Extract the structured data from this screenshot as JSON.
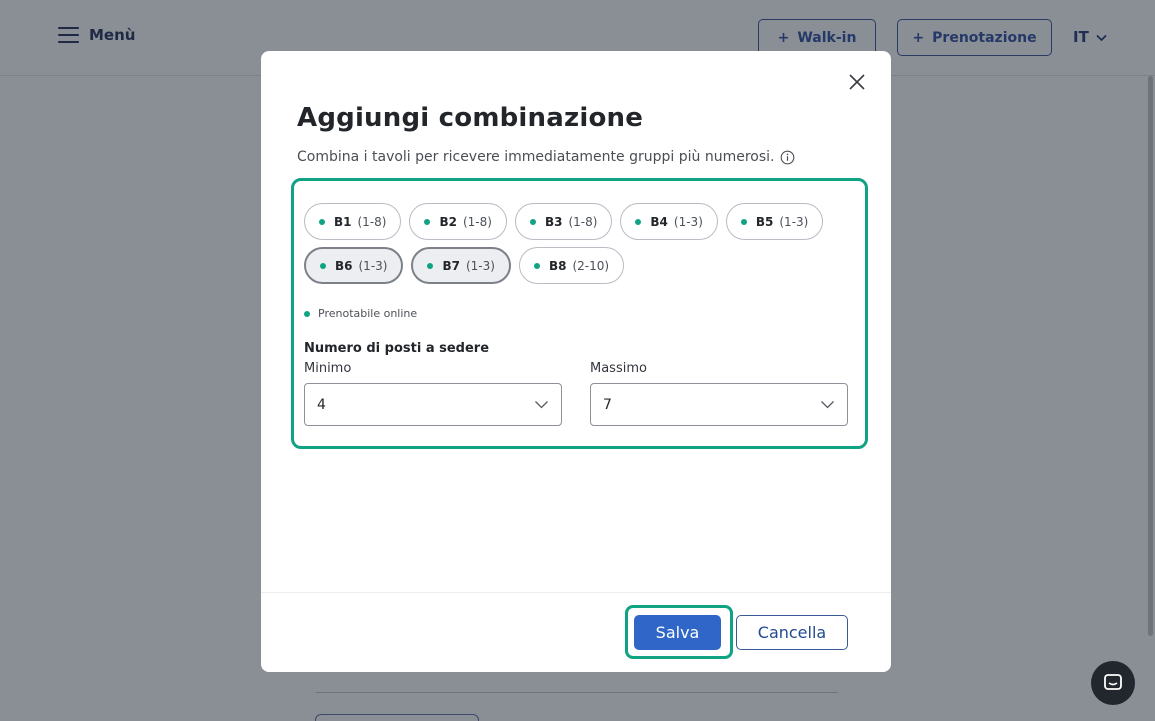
{
  "header": {
    "menu_label": "Menù",
    "walkin_label": "Walk-in",
    "reservation_label": "Prenotazione",
    "plus_glyph": "+",
    "language": "IT"
  },
  "modal": {
    "title": "Aggiungi combinazione",
    "description": "Combina i tavoli per ricevere immediatamente gruppi più numerosi.",
    "tables": [
      {
        "name": "B1",
        "capacity": "(1-8)",
        "selected": false
      },
      {
        "name": "B2",
        "capacity": "(1-8)",
        "selected": false
      },
      {
        "name": "B3",
        "capacity": "(1-8)",
        "selected": false
      },
      {
        "name": "B4",
        "capacity": "(1-3)",
        "selected": false
      },
      {
        "name": "B5",
        "capacity": "(1-3)",
        "selected": false
      },
      {
        "name": "B6",
        "capacity": "(1-3)",
        "selected": true
      },
      {
        "name": "B7",
        "capacity": "(1-3)",
        "selected": true
      },
      {
        "name": "B8",
        "capacity": "(2-10)",
        "selected": false
      }
    ],
    "legend_label": "Prenotabile online",
    "seats_label": "Numero di posti a sedere",
    "min_label": "Minimo",
    "max_label": "Massimo",
    "min_value": "4",
    "max_value": "7",
    "save_label": "Salva",
    "cancel_label": "Cancella"
  },
  "colors": {
    "accent_green": "#10a383",
    "primary_blue": "#2f66c7",
    "overlay": "#8a8e95"
  }
}
